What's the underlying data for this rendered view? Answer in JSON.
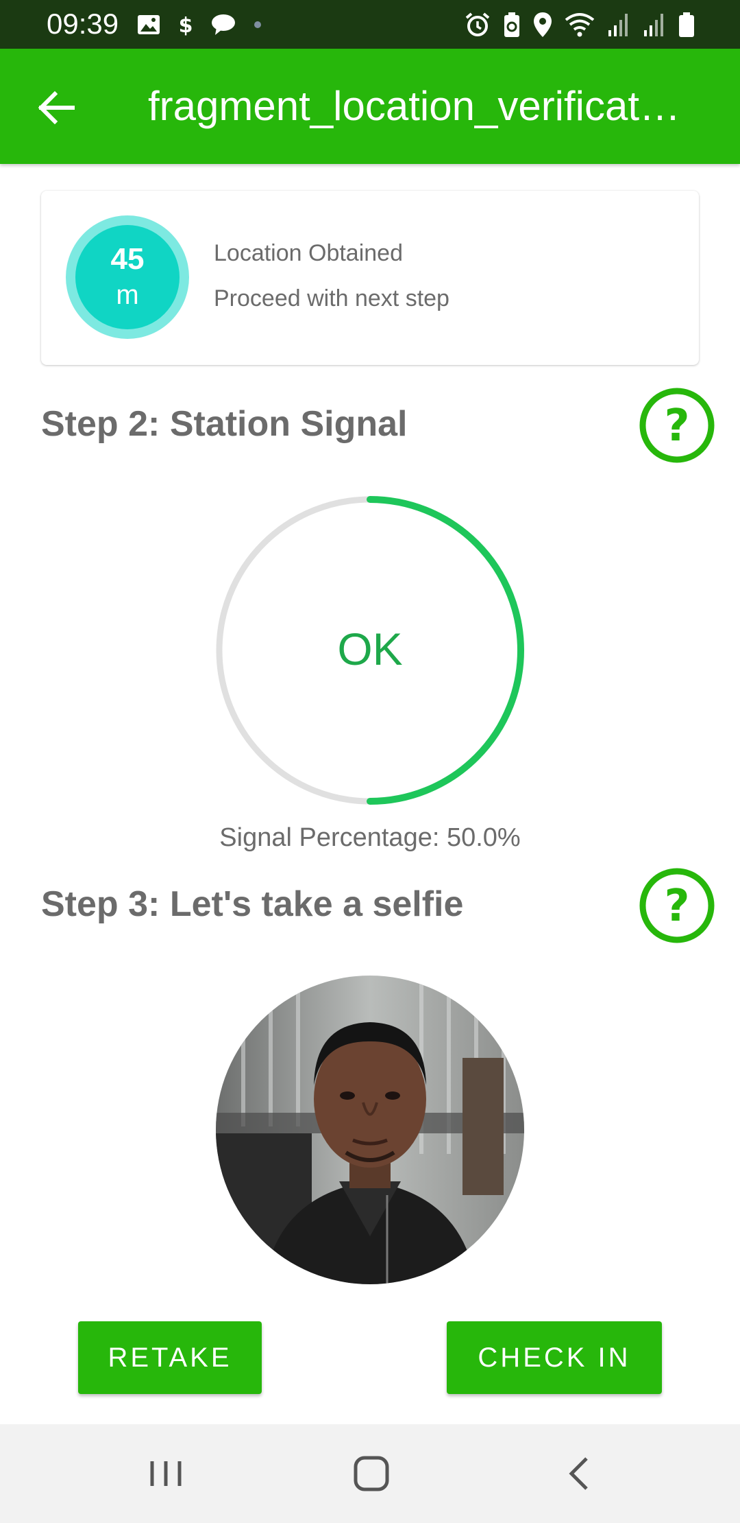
{
  "status_bar": {
    "time": "09:39",
    "left_icons": [
      "image-icon",
      "dollar-icon",
      "chat-bubble-icon",
      "dot-icon"
    ],
    "right_icons": [
      "alarm-icon",
      "battery-saver-icon",
      "location-pin-icon",
      "wifi-icon",
      "signal-icon",
      "signal-icon",
      "battery-icon"
    ]
  },
  "app_bar": {
    "title": "fragment_location_verification",
    "back_icon": "arrow-back-icon"
  },
  "location_card": {
    "distance_value": "45",
    "distance_unit": "m",
    "title": "Location Obtained",
    "subtitle": "Proceed with next step"
  },
  "step2": {
    "title": "Step 2: Station Signal",
    "help_icon": "help-circle-icon",
    "signal_status": "OK",
    "signal_fraction": 0.5,
    "signal_label": "Signal Percentage: 50.0%"
  },
  "step3": {
    "title": "Step 3: Let's take a selfie",
    "help_icon": "help-circle-icon"
  },
  "buttons": {
    "retake": "RETAKE",
    "check_in": "CHECK IN"
  },
  "nav_bar": {
    "icons": [
      "recent-apps-icon",
      "home-icon",
      "back-nav-icon"
    ]
  },
  "colors": {
    "primary": "#27b70b",
    "teal": "#10d5c4",
    "teal_light": "#7de9e1",
    "gauge": "#1ec65a",
    "gauge_track": "#e0e0e0"
  }
}
